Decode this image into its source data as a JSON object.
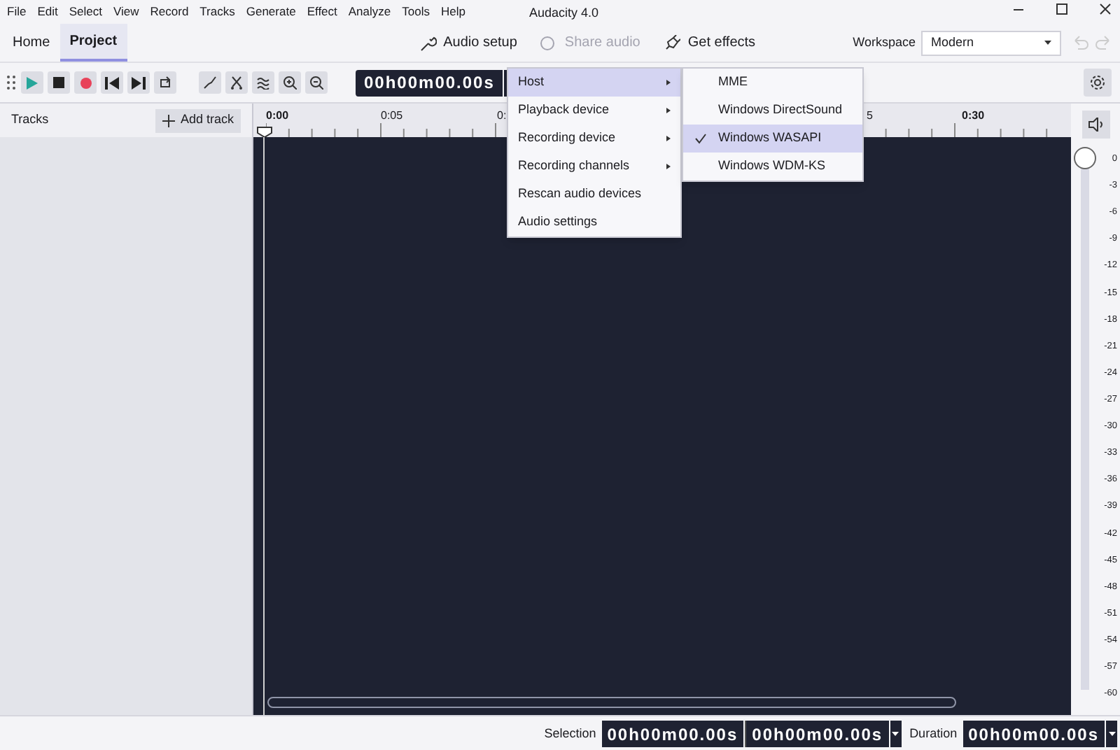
{
  "menu_bar": [
    "File",
    "Edit",
    "Select",
    "View",
    "Record",
    "Tracks",
    "Generate",
    "Effect",
    "Analyze",
    "Tools",
    "Help"
  ],
  "window": {
    "title": "Audacity 4.0"
  },
  "tabs": [
    {
      "label": "Home",
      "selected": false
    },
    {
      "label": "Project",
      "selected": true
    }
  ],
  "toolbar_actions": [
    {
      "label": "Audio setup",
      "disabled": false,
      "kind": "wrench"
    },
    {
      "label": "Share audio",
      "disabled": true,
      "kind": "share"
    },
    {
      "label": "Get effects",
      "disabled": false,
      "kind": "plug"
    }
  ],
  "workspace": {
    "label": "Workspace",
    "value": "Modern"
  },
  "timecode": "00h00m00.00s",
  "tracks_panel": {
    "title": "Tracks",
    "add_button": "Add track"
  },
  "ruler_labels": [
    "0:00",
    "0:05",
    "0:",
    "5",
    "0:30"
  ],
  "audio_menu": [
    {
      "label": "Host",
      "submenu": true,
      "selected": true
    },
    {
      "label": "Playback device",
      "submenu": true,
      "selected": false
    },
    {
      "label": "Recording device",
      "submenu": true,
      "selected": false
    },
    {
      "label": "Recording channels",
      "submenu": true,
      "selected": false
    },
    {
      "label": "Rescan audio devices",
      "submenu": false,
      "selected": false
    },
    {
      "label": "Audio settings",
      "submenu": false,
      "selected": false
    }
  ],
  "host_submenu": [
    {
      "label": "MME",
      "checked": false
    },
    {
      "label": "Windows DirectSound",
      "checked": false
    },
    {
      "label": "Windows WASAPI",
      "checked": true
    },
    {
      "label": "Windows WDM-KS",
      "checked": false
    }
  ],
  "meter": {
    "level": 1,
    "scale": [
      "0",
      "-3",
      "-6",
      "-9",
      "-12",
      "-15",
      "-18",
      "-21",
      "-24",
      "-27",
      "-30",
      "-33",
      "-36",
      "-39",
      "-42",
      "-45",
      "-48",
      "-51",
      "-54",
      "-57",
      "-60"
    ]
  },
  "status_bar": {
    "selection_label": "Selection",
    "selection_start": "00h00m00.00s",
    "selection_end": "00h00m00.00s",
    "duration_label": "Duration",
    "duration": "00h00m00.00s"
  }
}
